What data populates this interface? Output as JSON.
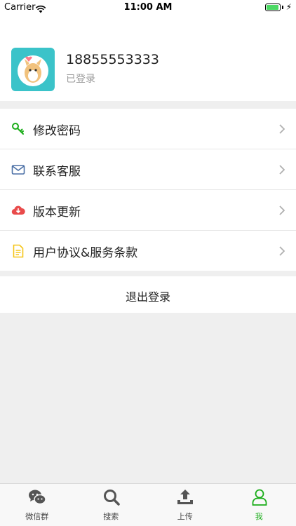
{
  "status_bar": {
    "carrier": "Carrier",
    "time": "11:00 AM",
    "battery_level": 0.95
  },
  "profile": {
    "username": "18855553333",
    "status": "已登录"
  },
  "menu": {
    "items": [
      {
        "label": "修改密码",
        "icon": "key-icon",
        "color": "#1aad19"
      },
      {
        "label": "联系客服",
        "icon": "mail-icon",
        "color": "#4a6fa5"
      },
      {
        "label": "版本更新",
        "icon": "cloud-download-icon",
        "color": "#e94b4b"
      },
      {
        "label": "用户协议&服务条款",
        "icon": "document-icon",
        "color": "#f5c518"
      }
    ]
  },
  "logout": {
    "label": "退出登录"
  },
  "tabbar": {
    "active_color": "#1aad19",
    "items": [
      {
        "label": "微信群",
        "icon": "wechat-icon"
      },
      {
        "label": "搜索",
        "icon": "search-icon"
      },
      {
        "label": "上传",
        "icon": "upload-icon"
      },
      {
        "label": "我",
        "icon": "user-icon",
        "active": true
      }
    ]
  }
}
